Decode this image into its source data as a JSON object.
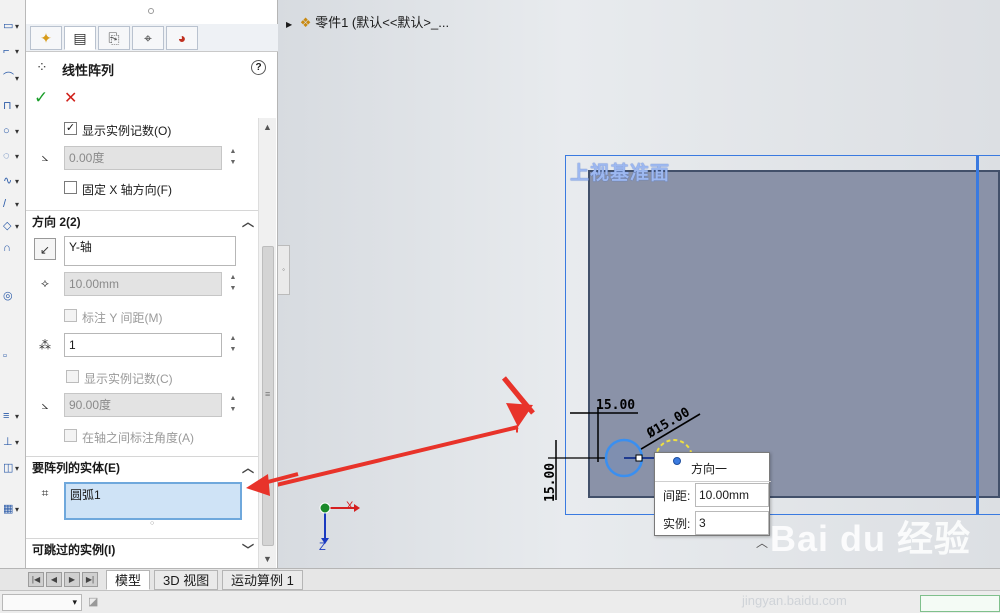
{
  "feature": {
    "title": "线性阵列",
    "help": "?",
    "ok": "✓",
    "cancel": "✕"
  },
  "direction1": {
    "show_instance_count_label": "显示实例记数(O)",
    "show_instance_count_checked": true,
    "angle_value": "0.00度",
    "fix_x_label": "固定 X 轴方向(F)",
    "fix_x_checked": false
  },
  "direction2": {
    "header": "方向 2(2)",
    "axis_value": "Y-轴",
    "spacing_value": "10.00mm",
    "dim_y_spacing_label": "标注 Y 间距(M)",
    "instances_value": "1",
    "show_instance_count_label": "显示实例记数(C)",
    "angle_value": "90.00度",
    "dim_angle_label": "在轴之间标注角度(A)"
  },
  "bodies": {
    "header": "要阵列的实体(E)",
    "item": "圆弧1"
  },
  "skip": {
    "header": "可跳过的实例(I)"
  },
  "bottom_tabs": [
    "模型",
    "3D 视图",
    "运动算例 1"
  ],
  "graphics": {
    "tree_item": "零件1 (默认<<默认>_...",
    "plane_label": "上视基准面",
    "dim_horizontal": "15.00",
    "dim_vertical": "15.00",
    "dim_diameter": "Ø15.00",
    "triad_x": "X",
    "triad_z": "Z"
  },
  "popup": {
    "title": "方向一",
    "spacing_label": "间距:",
    "spacing_value": "10.00mm",
    "instances_label": "实例:",
    "instances_value": "3"
  },
  "watermark": {
    "main": "Bai du 经验",
    "sub": "jingyan.baidu.com"
  },
  "colors": {
    "plane_border": "#3a7ae0",
    "plane_fill": "#8a92a8",
    "arrow_red": "#e8332a",
    "selection_blue": "#cfe3f6"
  }
}
